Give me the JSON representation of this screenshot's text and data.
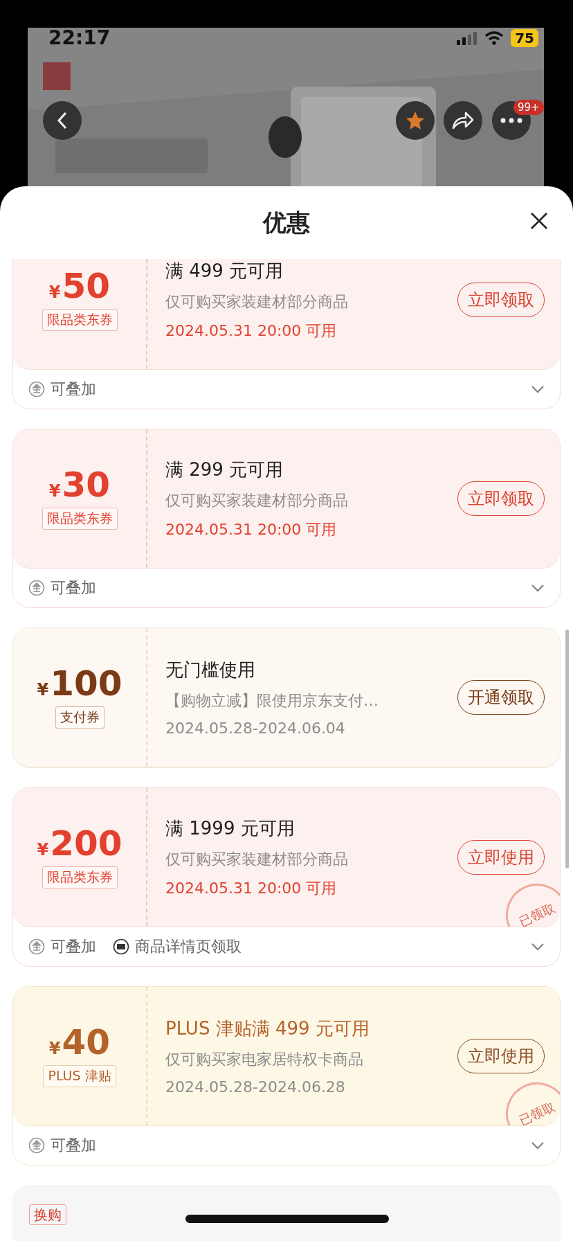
{
  "status_bar": {
    "time": "22:17",
    "battery": "75"
  },
  "header_actions": {
    "badge": "99+"
  },
  "sheet": {
    "title": "优惠"
  },
  "coupons": [
    {
      "kind": "limit",
      "symbol": "¥",
      "amount": "50",
      "tag": "限品类东券",
      "title": "满 499 元可用",
      "description": "仅可购买家装建材部分商品",
      "date": "2024.05.31 20:00 可用",
      "button": "立即领取",
      "footer": [
        {
          "kind": "stack",
          "text": "可叠加"
        }
      ]
    },
    {
      "kind": "limit",
      "symbol": "¥",
      "amount": "30",
      "tag": "限品类东券",
      "title": "满 299 元可用",
      "description": "仅可购买家装建材部分商品",
      "date": "2024.05.31 20:00 可用",
      "button": "立即领取",
      "footer": [
        {
          "kind": "stack",
          "text": "可叠加"
        }
      ]
    },
    {
      "kind": "pay",
      "symbol": "¥",
      "amount": "100",
      "tag": "支付券",
      "title": "无门槛使用",
      "description": "【购物立减】限使用京东支付…",
      "date": "2024.05.28-2024.06.04",
      "button": "开通领取"
    },
    {
      "kind": "limit",
      "symbol": "¥",
      "amount": "200",
      "tag": "限品类东券",
      "title": "满 1999 元可用",
      "description": "仅可购买家装建材部分商品",
      "date": "2024.05.31 20:00 可用",
      "button": "立即使用",
      "stamp": "已领取",
      "footer": [
        {
          "kind": "stack",
          "text": "可叠加"
        },
        {
          "kind": "detail",
          "text": "商品详情页领取"
        }
      ]
    },
    {
      "kind": "plus",
      "symbol": "¥",
      "amount": "40",
      "tag": "PLUS 津贴",
      "title": "PLUS 津贴满 499 元可用",
      "description": "仅可购买家电家居特权卡商品",
      "date": "2024.05.28-2024.06.28",
      "button": "立即使用",
      "stamp": "已领取",
      "footer": [
        {
          "kind": "stack",
          "text": "可叠加"
        }
      ]
    }
  ],
  "next_card": {
    "tag": "换购"
  }
}
